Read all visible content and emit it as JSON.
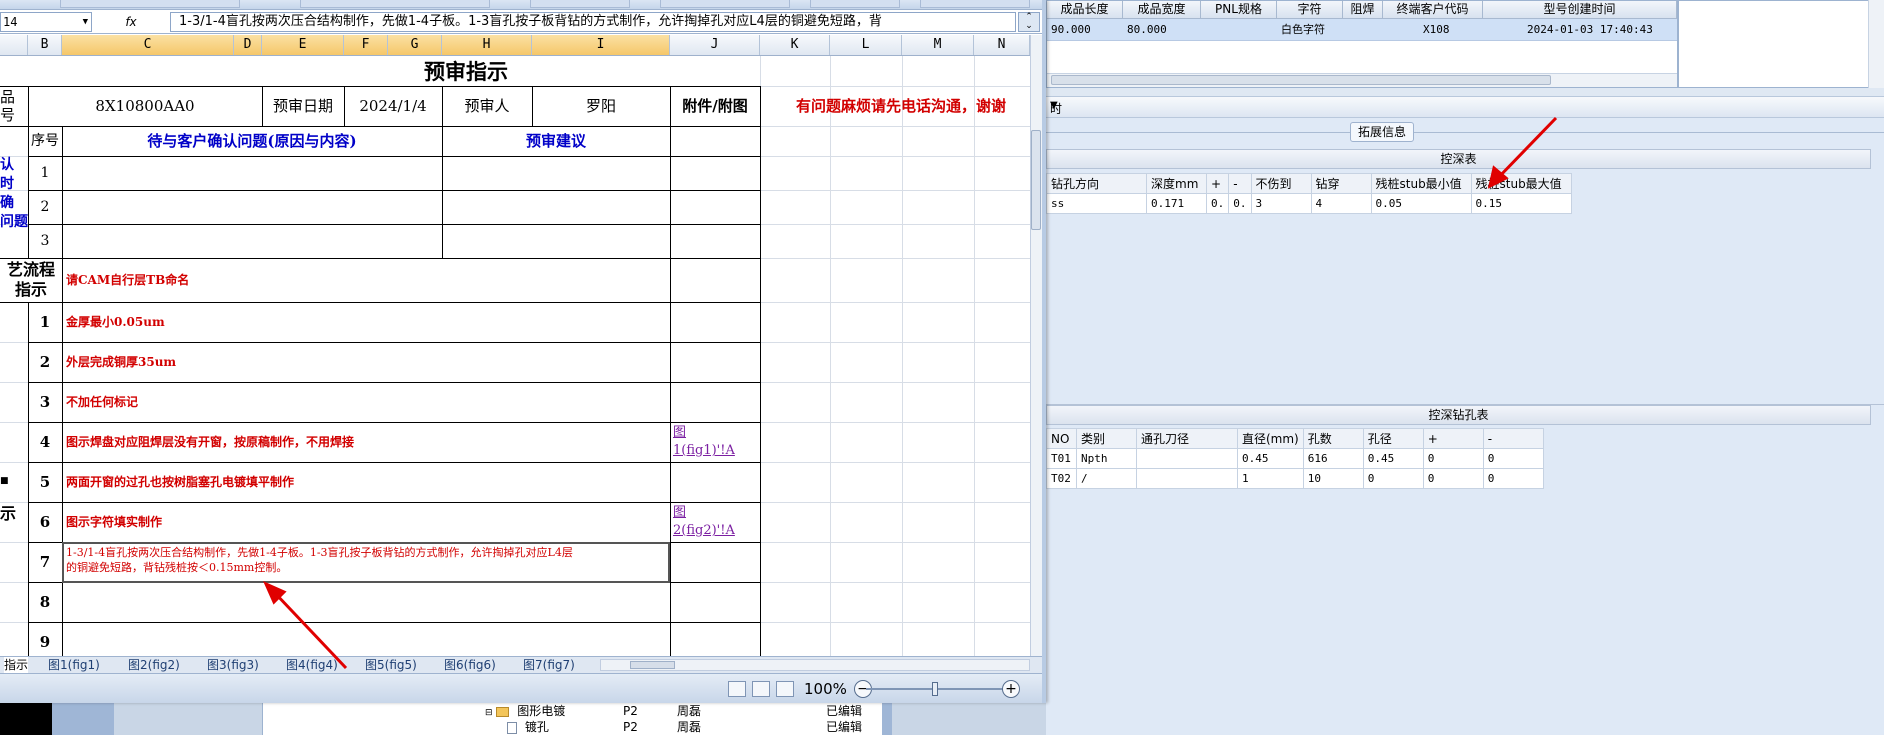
{
  "excel": {
    "name_box": "14",
    "fx_label": "fx",
    "formula_text": "1-3/1-4盲孔按两次压合结构制作，先做1-4子板。1-3盲孔按子板背钻的方式制作，允许掏掉孔对应L4层的铜避免短路，背",
    "columns": [
      "B",
      "C",
      "D",
      "E",
      "F",
      "G",
      "H",
      "I",
      "J",
      "K",
      "L",
      "M",
      "N"
    ],
    "sheet": {
      "title": "预审指示",
      "part_label": "品\n号",
      "part_number": "8X10800AA0",
      "date_label": "预审日期",
      "date_value": "2024/1/4",
      "reviewer_label": "预审人",
      "reviewer_name": "罗阳",
      "attach_label": "附件/附图",
      "notice": "有问题麻烦请先电话沟通，谢谢",
      "seq_label": "序号",
      "confirm_header": "待与客户确认问题(原因与内容)",
      "advice_header": "预审建议",
      "left_confirm_label": "认\n时\n确\n问题",
      "confirm_rows": [
        "1",
        "2",
        "3"
      ],
      "process_label": "艺流程\n指示",
      "process_text": "请CAM自行层TB命名",
      "left_bottom_label": "示",
      "items": [
        {
          "n": "1",
          "text": "金厚最小0.05um",
          "link": ""
        },
        {
          "n": "2",
          "text": "外层完成铜厚35um",
          "link": ""
        },
        {
          "n": "3",
          "text": "不加任何标记",
          "link": ""
        },
        {
          "n": "4",
          "text": "图示焊盘对应阻焊层没有开窗，按原稿制作，不用焊接",
          "link": "图\n1(fig1)'!A"
        },
        {
          "n": "5",
          "text": "两面开窗的过孔也按树脂塞孔电镀填平制作",
          "link": ""
        },
        {
          "n": "6",
          "text": "图示字符填实制作",
          "link": "图\n2(fig2)'!A"
        },
        {
          "n": "7",
          "text": "1-3/1-4盲孔按两次压合结构制作，先做1-4子板。1-3盲孔按子板背钻的方式制作，允许掏掉孔对应L4层\n的铜避免短路，背钻残桩按＜0.15mm控制。",
          "link": ""
        },
        {
          "n": "8",
          "text": "",
          "link": ""
        },
        {
          "n": "9",
          "text": "",
          "link": ""
        }
      ]
    },
    "sheet_tabs": [
      "指示",
      "图1(fig1)",
      "图2(fig2)",
      "图3(fig3)",
      "图4(fig4)",
      "图5(fig5)",
      "图6(fig6)",
      "图7(fig7)"
    ],
    "zoom": "100%"
  },
  "top_grid": {
    "headers": [
      "成品长度",
      "成品宽度",
      "PNL规格",
      "字符",
      "阻焊",
      "终端客户代码",
      "型号创建时间"
    ],
    "row": [
      "90.000",
      "80.000",
      "",
      "白色字符",
      "",
      "X108",
      "2024-01-03 17:40:43"
    ]
  },
  "section_bar_label": "时",
  "ext_tab_label": "拓展信息",
  "depth_table": {
    "title": "控深表",
    "headers": [
      "钻孔方向",
      "深度mm",
      "+",
      "-",
      "不伤到",
      "钻穿",
      "残桩stub最小值",
      "残桩stub最大值"
    ],
    "row": [
      "ss",
      "0.171",
      "0.",
      "0.",
      "3",
      "4",
      "0.05",
      "0.15"
    ]
  },
  "drill_table": {
    "title": "控深钻孔表",
    "headers": [
      "NO",
      "类别",
      "通孔刀径",
      "直径(mm)",
      "孔数",
      "孔径",
      "+",
      "-"
    ],
    "rows": [
      [
        "T01",
        "Npth",
        "",
        "0.45",
        "616",
        "0.45",
        "0",
        "0"
      ],
      [
        "T02",
        "/",
        "",
        "1",
        "10",
        "0",
        "0",
        "0"
      ]
    ]
  },
  "tree": [
    {
      "name": "图形电镀",
      "code": "P2",
      "user": "周磊",
      "status": "已编辑"
    },
    {
      "name": "镀孔",
      "code": "P2",
      "user": "周磊",
      "status": "已编辑"
    }
  ],
  "colors": {
    "red": "#d20000",
    "blue": "#0000c8",
    "selected_col": "#f5c76a"
  }
}
